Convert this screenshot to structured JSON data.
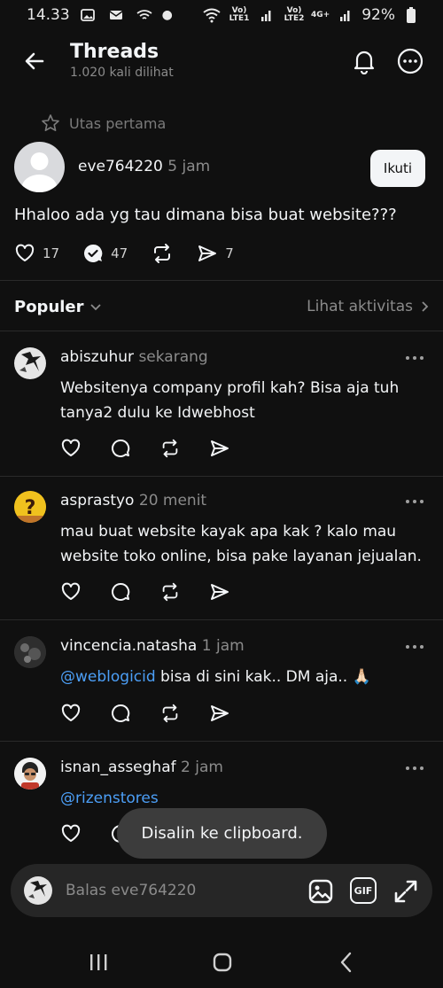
{
  "status": {
    "time": "14.33",
    "signal1": "Vo) LTE1",
    "signal2": "Vo) LTE2",
    "net": "4G+",
    "battery": "92%"
  },
  "header": {
    "title": "Threads",
    "subtitle": "1.020 kali dilihat"
  },
  "first_thread_label": "Utas pertama",
  "op": {
    "username": "eve764220",
    "time": "5 jam",
    "follow_label": "Ikuti",
    "text": "Hhaloo ada yg tau dimana bisa buat website???",
    "likes": "17",
    "replies": "47",
    "shares": "7"
  },
  "sort": {
    "label": "Populer",
    "activity": "Lihat aktivitas"
  },
  "replies": [
    {
      "username": "abiszuhur",
      "time": "sekarang",
      "text": "Websitenya company profil kah? Bisa aja tuh tanya2 dulu ke Idwebhost",
      "mention": ""
    },
    {
      "username": "asprastyo",
      "time": "20 menit",
      "text": "mau buat website kayak apa kak ? kalo mau website toko online, bisa pake layanan jejualan.",
      "mention": ""
    },
    {
      "username": "vincencia.natasha",
      "time": "1 jam",
      "text": " bisa di sini kak.. DM aja.. 🙏🏻",
      "mention": "@weblogicid"
    },
    {
      "username": "isnan_asseghaf",
      "time": "2 jam",
      "text": "",
      "mention": "@rizenstores"
    }
  ],
  "toast": "Disalin ke clipboard.",
  "reply_bar": {
    "placeholder": "Balas eve764220",
    "gif_label": "GIF"
  },
  "colors": {
    "background": "#101010",
    "text": "#f3f5f7",
    "muted": "#8b8b8b",
    "mention": "#4c9ff7",
    "toast": "#3c3c3c",
    "input": "#262626"
  }
}
